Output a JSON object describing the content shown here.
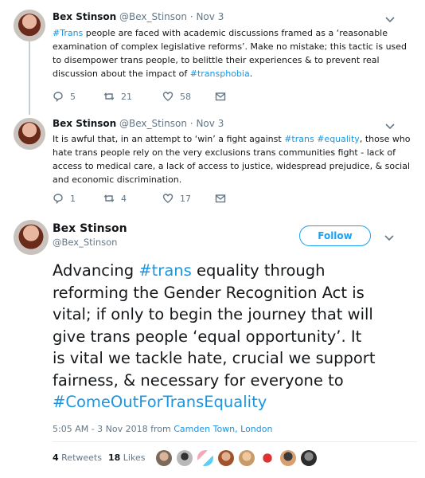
{
  "tweet1": {
    "name": "Bex Stinson",
    "handle": "@Bex_Stinson",
    "dot": "·",
    "date": "Nov 3",
    "line1_tag": "#Trans",
    "line1_rest": " people are faced with academic discussions framed as a ‘reasonable",
    "line2": "examination of complex legislative reforms’. Make no mistake; this tactic is used",
    "line3": "to disempower trans people, to belittle their experiences & to prevent real",
    "line4_start": "discussion about the impact of ",
    "line4_tag": "#transphobia",
    "line4_end": ".",
    "replies": "5",
    "retweets": "21",
    "likes": "58"
  },
  "tweet2": {
    "name": "Bex Stinson",
    "handle": "@Bex_Stinson",
    "dot": "·",
    "date": "Nov 3",
    "line1_start": "It is awful that, in an attempt to ‘win’ a fight against ",
    "line1_tag1": "#trans",
    "line1_space": " ",
    "line1_tag2": "#equality",
    "line1_end": ", those who",
    "line2": "hate trans people rely on the very exclusions trans communities fight - lack of",
    "line3": "access to medical care, a lack of access to justice, widespread prejudice, & social",
    "line4": "and economic discrimination.",
    "replies": "1",
    "retweets": "4",
    "likes": "17"
  },
  "main": {
    "name": "Bex Stinson",
    "handle": "@Bex_Stinson",
    "follow_label": "Follow",
    "line1_start": "Advancing ",
    "line1_tag": "#trans",
    "line1_end": " equality through",
    "line2": "reforming the Gender Recognition Act is",
    "line3": "vital; if only to begin the journey that will",
    "line4": "give trans people ‘equal opportunity’. It",
    "line5": "is vital we tackle hate, crucial we support",
    "line6": "fairness, & necessary for everyone to",
    "line7_tag": "#ComeOutForTransEquality",
    "time": "5:05 AM - 3 Nov 2018 from ",
    "location": "Camden Town, London",
    "retweets_count": "4",
    "retweets_label": " Retweets",
    "likes_count": "18",
    "likes_label": " Likes"
  },
  "colors": {
    "accent": "#1da1f2",
    "link": "#1b95e0",
    "meta": "#657786",
    "thread_line": "#c4cfd6"
  },
  "icons": [
    "reply-icon",
    "retweet-icon",
    "like-icon",
    "dm-icon",
    "chevron-down-icon"
  ]
}
